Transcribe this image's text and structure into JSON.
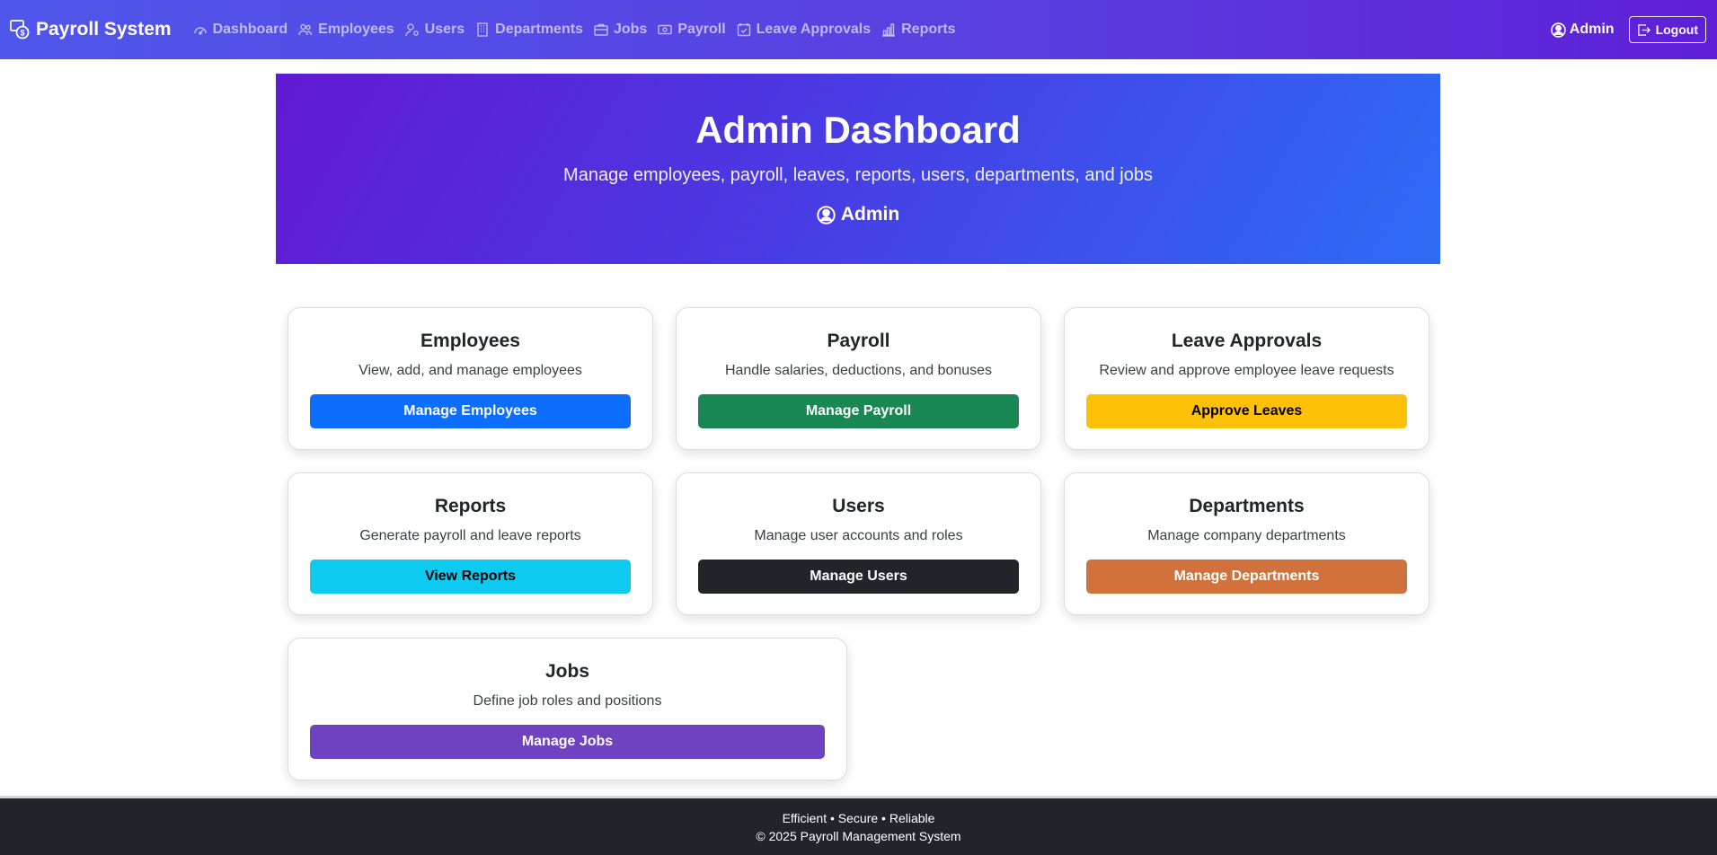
{
  "navbar": {
    "brand": "Payroll System",
    "links": [
      {
        "label": "Dashboard",
        "icon": "speedometer-icon"
      },
      {
        "label": "Employees",
        "icon": "people-icon"
      },
      {
        "label": "Users",
        "icon": "person-gear-icon"
      },
      {
        "label": "Departments",
        "icon": "building-icon"
      },
      {
        "label": "Jobs",
        "icon": "briefcase-icon"
      },
      {
        "label": "Payroll",
        "icon": "cash-icon"
      },
      {
        "label": "Leave Approvals",
        "icon": "calendar-check-icon"
      },
      {
        "label": "Reports",
        "icon": "bar-chart-icon"
      }
    ],
    "user": "Admin",
    "logout": "Logout"
  },
  "hero": {
    "title": "Admin Dashboard",
    "subtitle": "Manage employees, payroll, leaves, reports, users, departments, and jobs",
    "user": "Admin"
  },
  "cards": [
    {
      "title": "Employees",
      "desc": "View, add, and manage employees",
      "button": "Manage Employees",
      "color": "#0d6efd",
      "text_color": "#ffffff"
    },
    {
      "title": "Payroll",
      "desc": "Handle salaries, deductions, and bonuses",
      "button": "Manage Payroll",
      "color": "#198754",
      "text_color": "#ffffff"
    },
    {
      "title": "Leave Approvals",
      "desc": "Review and approve employee leave requests",
      "button": "Approve Leaves",
      "color": "#ffc107",
      "text_color": "#000000"
    },
    {
      "title": "Reports",
      "desc": "Generate payroll and leave reports",
      "button": "View Reports",
      "color": "#0dcaf0",
      "text_color": "#000000"
    },
    {
      "title": "Users",
      "desc": "Manage user accounts and roles",
      "button": "Manage Users",
      "color": "#212529",
      "text_color": "#ffffff"
    },
    {
      "title": "Departments",
      "desc": "Manage company departments",
      "button": "Manage Departments",
      "color": "#d1723c",
      "text_color": "#ffffff"
    },
    {
      "title": "Jobs",
      "desc": "Define job roles and positions",
      "button": "Manage Jobs",
      "color": "#6f42c1",
      "text_color": "#ffffff"
    }
  ],
  "footer": {
    "tagline": "Efficient • Secure • Reliable",
    "copyright": "© 2025 Payroll Management System"
  }
}
